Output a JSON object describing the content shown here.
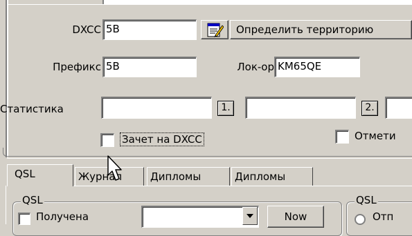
{
  "form": {
    "dxcc_label": "DXCC",
    "dxcc_value": "5B",
    "determine_button": "Определить территорию",
    "prefix_label": "Префикс",
    "prefix_value": "5B",
    "locator_label": "Лок-ор",
    "locator_value": "KM65QE",
    "statistics_label": "Статистика",
    "stat_button_1": "1.",
    "stat_button_2": "2.",
    "dxcc_credit_label": "Зачет на DXCC",
    "mark_label": "Отмети"
  },
  "tabs": [
    {
      "label": "QSL",
      "active": true
    },
    {
      "label": "Журнал",
      "active": false
    },
    {
      "label": "Дипломы",
      "active": false
    },
    {
      "label": "Дипломы",
      "active": false
    }
  ],
  "qsl_panel": {
    "group_title": "QSL",
    "received_label": "Получена",
    "now_button": "Now",
    "right_group_title": "QSL",
    "right_radio_label": "Отп"
  },
  "icons": {
    "determine_icon": "notepad-pencil-icon",
    "cursor": "arrow-cursor-icon"
  }
}
